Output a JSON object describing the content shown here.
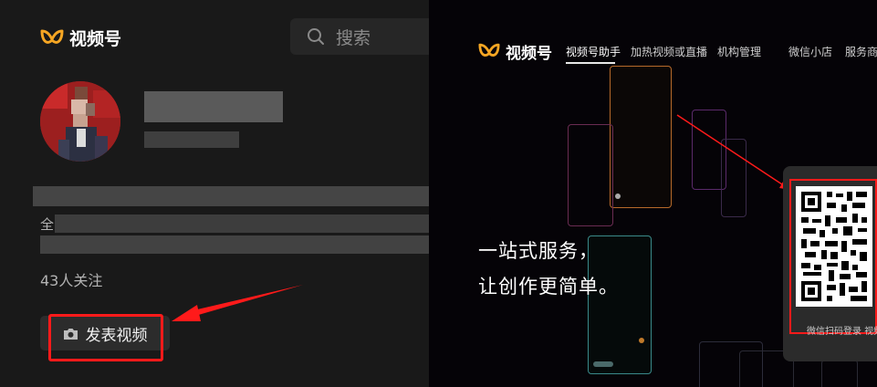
{
  "left": {
    "brand": "视频号",
    "search_placeholder": "搜索",
    "profile_line_fragment": "全",
    "followers": "43人关注",
    "publish_button": "发表视频"
  },
  "right": {
    "brand": "视频号",
    "nav": [
      "视频号助手",
      "加热视频或直播",
      "机构管理",
      "微信小店",
      "服务商"
    ],
    "tagline_1": "一站式服务，",
    "tagline_2": "让创作更简单。",
    "qr_caption": "微信扫码登录 视频号"
  },
  "colors": {
    "brand_orange": "#f6a623",
    "annotation_red": "#ff1a1a",
    "left_bg": "#191919",
    "right_bg": "#050307"
  },
  "icons": [
    "logo-butterfly-icon",
    "search-icon",
    "camera-icon",
    "qr-code"
  ]
}
